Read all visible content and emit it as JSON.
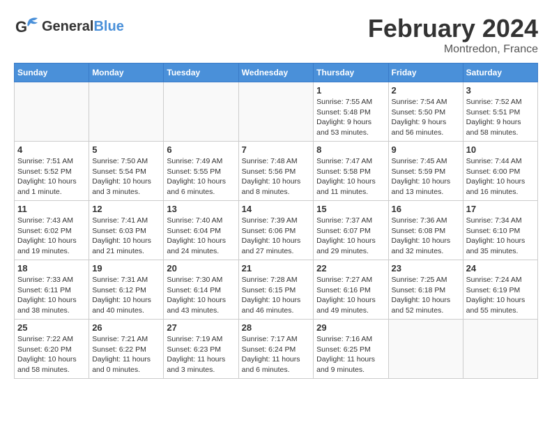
{
  "header": {
    "logo_general": "General",
    "logo_blue": "Blue",
    "month_title": "February 2024",
    "location": "Montredon, France"
  },
  "weekdays": [
    "Sunday",
    "Monday",
    "Tuesday",
    "Wednesday",
    "Thursday",
    "Friday",
    "Saturday"
  ],
  "weeks": [
    [
      {
        "day": "",
        "info": ""
      },
      {
        "day": "",
        "info": ""
      },
      {
        "day": "",
        "info": ""
      },
      {
        "day": "",
        "info": ""
      },
      {
        "day": "1",
        "info": "Sunrise: 7:55 AM\nSunset: 5:48 PM\nDaylight: 9 hours\nand 53 minutes."
      },
      {
        "day": "2",
        "info": "Sunrise: 7:54 AM\nSunset: 5:50 PM\nDaylight: 9 hours\nand 56 minutes."
      },
      {
        "day": "3",
        "info": "Sunrise: 7:52 AM\nSunset: 5:51 PM\nDaylight: 9 hours\nand 58 minutes."
      }
    ],
    [
      {
        "day": "4",
        "info": "Sunrise: 7:51 AM\nSunset: 5:52 PM\nDaylight: 10 hours\nand 1 minute."
      },
      {
        "day": "5",
        "info": "Sunrise: 7:50 AM\nSunset: 5:54 PM\nDaylight: 10 hours\nand 3 minutes."
      },
      {
        "day": "6",
        "info": "Sunrise: 7:49 AM\nSunset: 5:55 PM\nDaylight: 10 hours\nand 6 minutes."
      },
      {
        "day": "7",
        "info": "Sunrise: 7:48 AM\nSunset: 5:56 PM\nDaylight: 10 hours\nand 8 minutes."
      },
      {
        "day": "8",
        "info": "Sunrise: 7:47 AM\nSunset: 5:58 PM\nDaylight: 10 hours\nand 11 minutes."
      },
      {
        "day": "9",
        "info": "Sunrise: 7:45 AM\nSunset: 5:59 PM\nDaylight: 10 hours\nand 13 minutes."
      },
      {
        "day": "10",
        "info": "Sunrise: 7:44 AM\nSunset: 6:00 PM\nDaylight: 10 hours\nand 16 minutes."
      }
    ],
    [
      {
        "day": "11",
        "info": "Sunrise: 7:43 AM\nSunset: 6:02 PM\nDaylight: 10 hours\nand 19 minutes."
      },
      {
        "day": "12",
        "info": "Sunrise: 7:41 AM\nSunset: 6:03 PM\nDaylight: 10 hours\nand 21 minutes."
      },
      {
        "day": "13",
        "info": "Sunrise: 7:40 AM\nSunset: 6:04 PM\nDaylight: 10 hours\nand 24 minutes."
      },
      {
        "day": "14",
        "info": "Sunrise: 7:39 AM\nSunset: 6:06 PM\nDaylight: 10 hours\nand 27 minutes."
      },
      {
        "day": "15",
        "info": "Sunrise: 7:37 AM\nSunset: 6:07 PM\nDaylight: 10 hours\nand 29 minutes."
      },
      {
        "day": "16",
        "info": "Sunrise: 7:36 AM\nSunset: 6:08 PM\nDaylight: 10 hours\nand 32 minutes."
      },
      {
        "day": "17",
        "info": "Sunrise: 7:34 AM\nSunset: 6:10 PM\nDaylight: 10 hours\nand 35 minutes."
      }
    ],
    [
      {
        "day": "18",
        "info": "Sunrise: 7:33 AM\nSunset: 6:11 PM\nDaylight: 10 hours\nand 38 minutes."
      },
      {
        "day": "19",
        "info": "Sunrise: 7:31 AM\nSunset: 6:12 PM\nDaylight: 10 hours\nand 40 minutes."
      },
      {
        "day": "20",
        "info": "Sunrise: 7:30 AM\nSunset: 6:14 PM\nDaylight: 10 hours\nand 43 minutes."
      },
      {
        "day": "21",
        "info": "Sunrise: 7:28 AM\nSunset: 6:15 PM\nDaylight: 10 hours\nand 46 minutes."
      },
      {
        "day": "22",
        "info": "Sunrise: 7:27 AM\nSunset: 6:16 PM\nDaylight: 10 hours\nand 49 minutes."
      },
      {
        "day": "23",
        "info": "Sunrise: 7:25 AM\nSunset: 6:18 PM\nDaylight: 10 hours\nand 52 minutes."
      },
      {
        "day": "24",
        "info": "Sunrise: 7:24 AM\nSunset: 6:19 PM\nDaylight: 10 hours\nand 55 minutes."
      }
    ],
    [
      {
        "day": "25",
        "info": "Sunrise: 7:22 AM\nSunset: 6:20 PM\nDaylight: 10 hours\nand 58 minutes."
      },
      {
        "day": "26",
        "info": "Sunrise: 7:21 AM\nSunset: 6:22 PM\nDaylight: 11 hours\nand 0 minutes."
      },
      {
        "day": "27",
        "info": "Sunrise: 7:19 AM\nSunset: 6:23 PM\nDaylight: 11 hours\nand 3 minutes."
      },
      {
        "day": "28",
        "info": "Sunrise: 7:17 AM\nSunset: 6:24 PM\nDaylight: 11 hours\nand 6 minutes."
      },
      {
        "day": "29",
        "info": "Sunrise: 7:16 AM\nSunset: 6:25 PM\nDaylight: 11 hours\nand 9 minutes."
      },
      {
        "day": "",
        "info": ""
      },
      {
        "day": "",
        "info": ""
      }
    ]
  ]
}
